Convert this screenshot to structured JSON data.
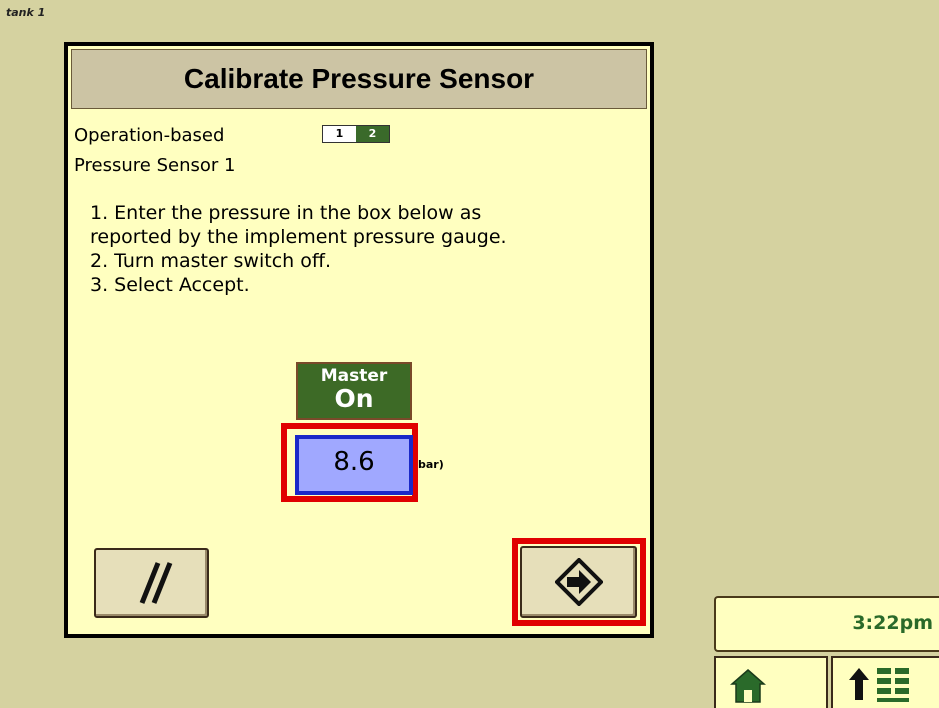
{
  "header": {
    "tank_label": "tank 1"
  },
  "dialog": {
    "title": "Calibrate Pressure Sensor",
    "mode_label": "Operation-based",
    "mode_options": [
      "1",
      "2"
    ],
    "mode_selected": "2",
    "sensor_name": "Pressure Sensor 1",
    "instructions": [
      "1. Enter the pressure in the box below as",
      "reported by the implement pressure gauge.",
      "2. Turn master switch off.",
      "3. Select Accept."
    ],
    "master": {
      "label": "Master",
      "state": "On"
    },
    "pressure": {
      "value": "8.6",
      "unit": "bar)"
    }
  },
  "status": {
    "time": "3:22pm"
  },
  "icons": {
    "cancel": "cancel-slashes-icon",
    "accept": "accept-arrow-icon",
    "home": "home-icon",
    "menu": "menu-up-arrow-icon"
  },
  "colors": {
    "background": "#d5d2a0",
    "dialog": "#ffffc0",
    "title_bar": "#ccc4a4",
    "master_on": "#3d6a26",
    "input": "#a0a8ff",
    "highlight": "#e00000",
    "time": "#2a6a2a"
  }
}
